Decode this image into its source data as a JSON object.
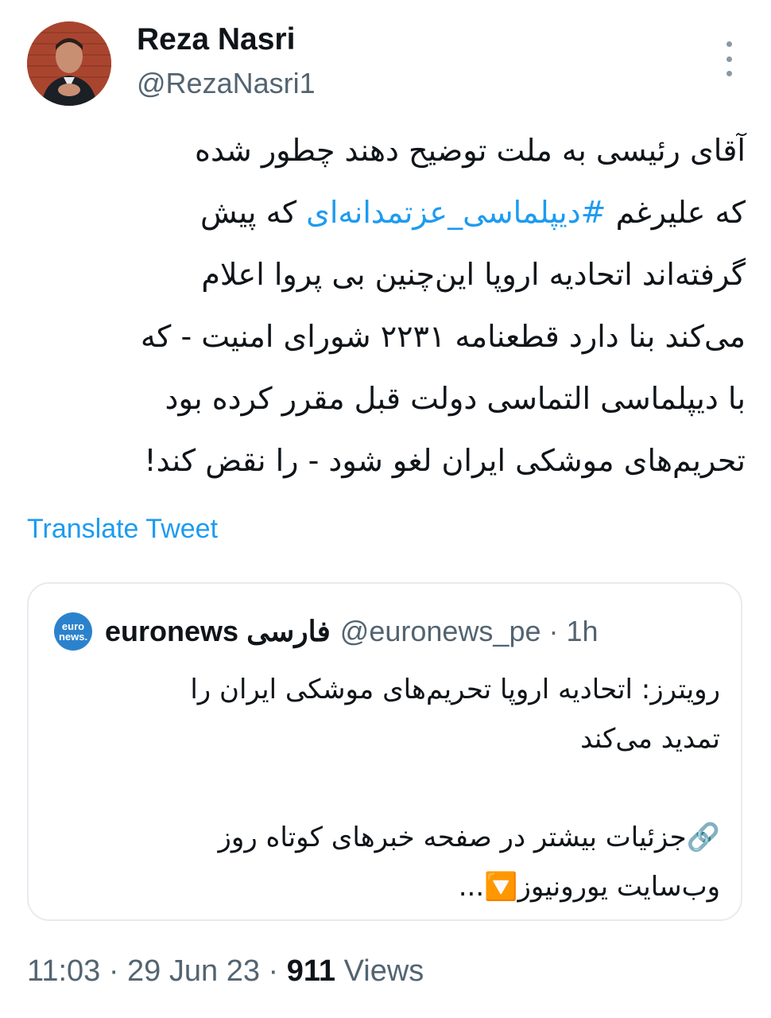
{
  "author": {
    "name": "Reza Nasri",
    "handle": "@RezaNasri1"
  },
  "tweet": {
    "lines_before_hashtag": [
      "آقای رئیسی به ملت توضیح دهند چطور شده"
    ],
    "line2_prefix": "که علیرغم ",
    "hashtag": "#دیپلماسی_عزتمدانه‌ای",
    "line2_suffix": " که پیش",
    "lines_after": [
      "گرفته‌اند اتحادیه اروپا این‌چنین بی پروا اعلام",
      "می‌کند بنا دارد قطعنامه ۲۲۳۱ شورای امنیت - که",
      "با دیپلماسی التماسی دولت قبل مقرر کرده بود",
      "تحریم‌های موشکی ایران لغو شود - را نقض کند!"
    ]
  },
  "translate_label": "Translate Tweet",
  "quoted": {
    "logo_top": "euro",
    "logo_bottom": "news.",
    "name": "euronews فارسی",
    "meta": "@euronews_pe · 1h",
    "lines": [
      "رویترز: اتحادیه اروپا تحریم‌های موشکی ایران را",
      "تمدید می‌کند"
    ],
    "lines2": [
      "🔗جزئیات بیشتر در صفحه خبرهای کوتاه روز",
      "وب‌سایت یورونیوز🔽..."
    ]
  },
  "footer": {
    "time_date": "11:03 · 29 Jun 23 · ",
    "views_count": "911",
    "views_label": " Views"
  }
}
